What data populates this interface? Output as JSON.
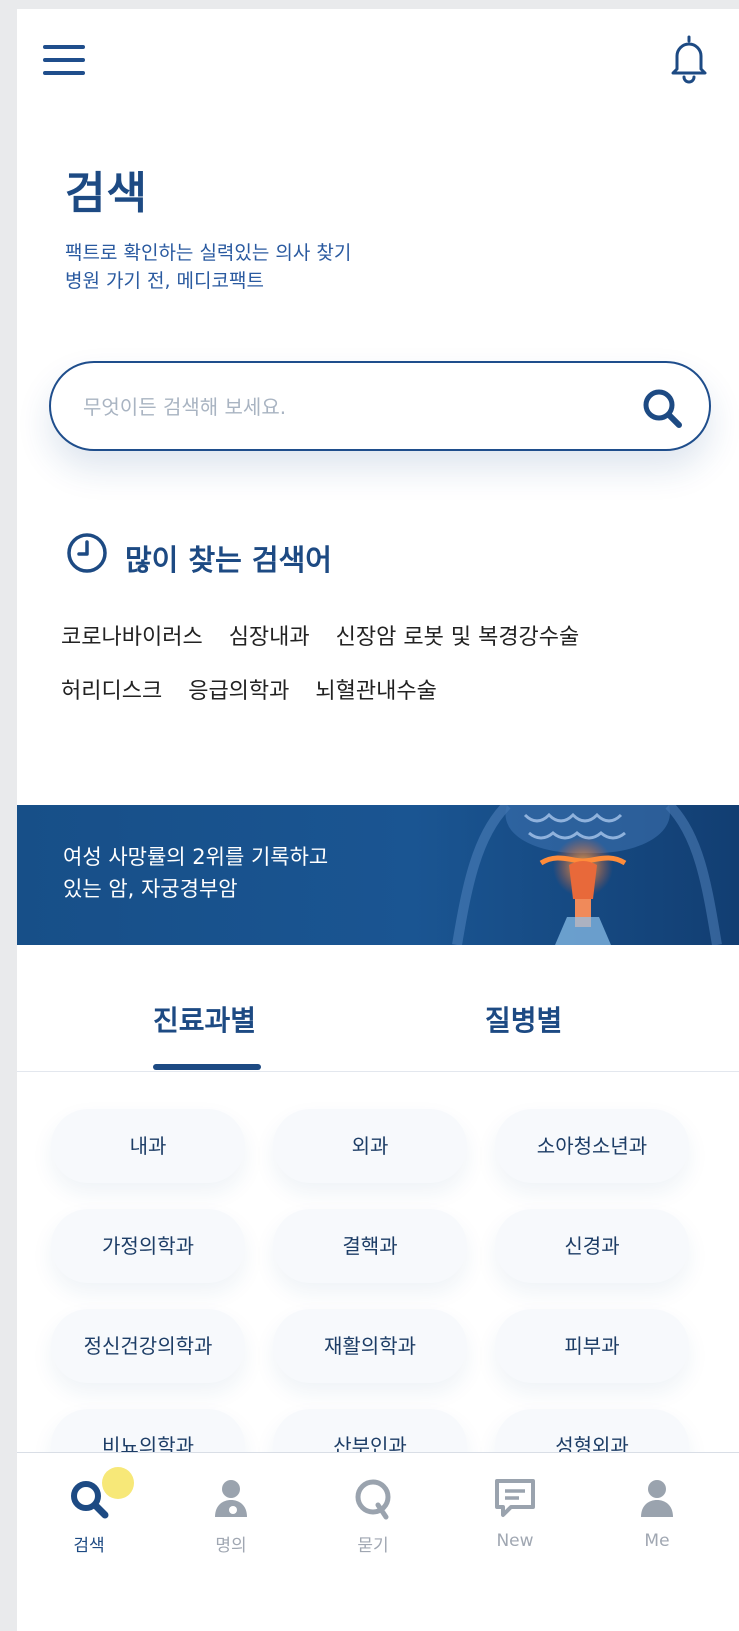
{
  "header": {
    "menu_icon": "hamburger-menu-icon",
    "bell_icon": "bell-icon"
  },
  "page": {
    "title": "검색",
    "subtitle_line1": "팩트로 확인하는 실력있는 의사 찾기",
    "subtitle_line2": "병원 가기 전, 메디코팩트"
  },
  "search": {
    "placeholder": "무엇이든 검색해 보세요.",
    "value": "",
    "icon": "search-icon"
  },
  "popular": {
    "title": "많이 찾는 검색어",
    "icon": "clock-icon",
    "row1": [
      "코로나바이러스",
      "심장내과",
      "신장암 로봇 및 복경강수술"
    ],
    "row2": [
      "허리디스크",
      "응급의학과",
      "뇌혈관내수술"
    ]
  },
  "banner": {
    "line1": "여성 사망률의 2위를 기록하고",
    "line2": "있는 암, 자궁경부암"
  },
  "tabs": [
    {
      "label": "진료과별",
      "active": true
    },
    {
      "label": "질병별",
      "active": false
    }
  ],
  "departments": [
    "내과",
    "외과",
    "소아청소년과",
    "가정의학과",
    "결핵과",
    "신경과",
    "정신건강의학과",
    "재활의학과",
    "피부과",
    "비뇨의학과",
    "산부인과",
    "성형외과"
  ],
  "bottom_nav": [
    {
      "label": "검색",
      "icon": "search-icon",
      "active": true
    },
    {
      "label": "명의",
      "icon": "doctor-icon",
      "active": false
    },
    {
      "label": "묻기",
      "icon": "q-icon",
      "active": false
    },
    {
      "label": "New",
      "icon": "chat-icon",
      "active": false
    },
    {
      "label": "Me",
      "icon": "person-icon",
      "active": false
    }
  ],
  "colors": {
    "primary": "#1d4a83",
    "accent": "#f7e878",
    "banner_bg": "#1a5592"
  }
}
